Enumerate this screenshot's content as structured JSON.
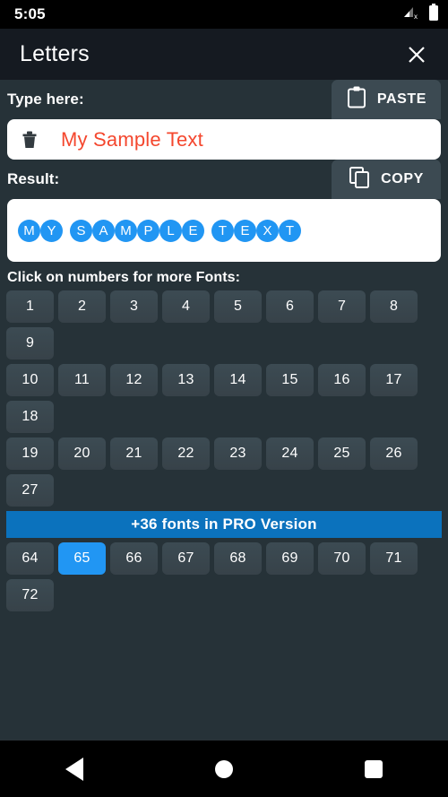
{
  "statusbar": {
    "time": "5:05",
    "signal_icon": "signal-no-service-icon",
    "battery_icon": "battery-full-icon"
  },
  "titlebar": {
    "title": "Letters",
    "close_icon": "close-icon"
  },
  "input_section": {
    "label": "Type here:",
    "paste_label": "PASTE",
    "paste_icon": "clipboard-icon",
    "clear_icon": "trash-icon",
    "value": "My Sample Text",
    "placeholder": "Type here"
  },
  "result_section": {
    "label": "Result:",
    "copy_label": "COPY",
    "copy_icon": "copy-icon",
    "value": "MY SAMPLE TEXT",
    "letter_color": "#2196f3"
  },
  "fonts_section": {
    "caption": "Click on numbers for more Fonts:",
    "rows": [
      [
        "1",
        "2",
        "3",
        "4",
        "5",
        "6",
        "7",
        "8",
        "9"
      ],
      [
        "10",
        "11",
        "12",
        "13",
        "14",
        "15",
        "16",
        "17",
        "18"
      ],
      [
        "19",
        "20",
        "21",
        "22",
        "23",
        "24",
        "25",
        "26",
        "27"
      ]
    ],
    "pro_banner": "+36 fonts in PRO Version",
    "rows_after": [
      [
        "64",
        "65",
        "66",
        "67",
        "68",
        "69",
        "70",
        "71",
        "72"
      ]
    ],
    "selected": "65"
  },
  "navbar": {
    "back_icon": "back-triangle-icon",
    "home_icon": "home-circle-icon",
    "recents_icon": "recents-square-icon"
  },
  "colors": {
    "background": "#263238",
    "titlebar": "#151a21",
    "accent": "#2196f3",
    "pro_banner": "#0b72bd",
    "input_text": "#f4472e",
    "button": "#3c4a52"
  }
}
